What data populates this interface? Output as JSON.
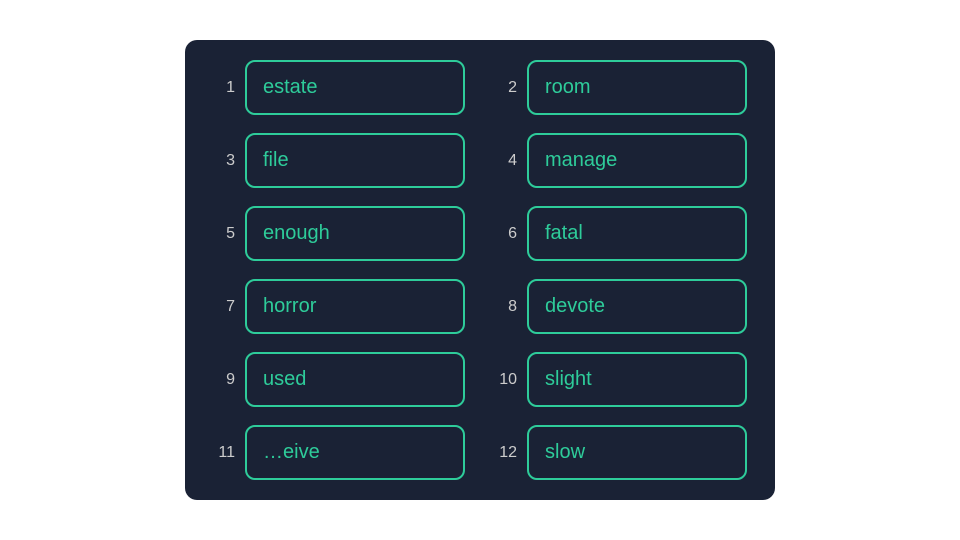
{
  "words": [
    {
      "number": "1",
      "text": "estate"
    },
    {
      "number": "2",
      "text": "room"
    },
    {
      "number": "3",
      "text": "file"
    },
    {
      "number": "4",
      "text": "manage"
    },
    {
      "number": "5",
      "text": "enough"
    },
    {
      "number": "6",
      "text": "fatal"
    },
    {
      "number": "7",
      "text": "horror"
    },
    {
      "number": "8",
      "text": "devote"
    },
    {
      "number": "9",
      "text": "used"
    },
    {
      "number": "10",
      "text": "slight"
    },
    {
      "number": "11",
      "text": "…eive"
    },
    {
      "number": "12",
      "text": "slow"
    }
  ]
}
